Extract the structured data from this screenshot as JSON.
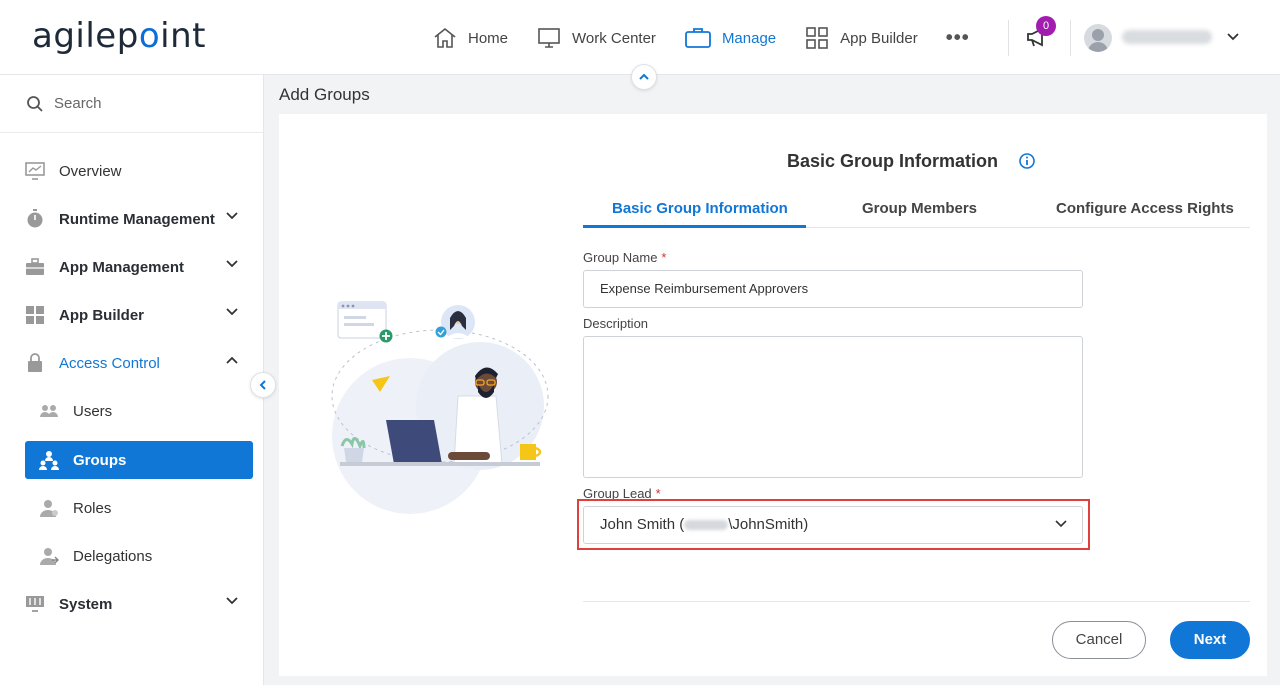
{
  "app": {
    "logo_text": "agilepoint"
  },
  "nav": {
    "items": [
      {
        "label": "Home",
        "icon": "home-icon"
      },
      {
        "label": "Work Center",
        "icon": "monitor-icon"
      },
      {
        "label": "Manage",
        "icon": "briefcase-icon",
        "active": true
      },
      {
        "label": "App Builder",
        "icon": "grid-icon"
      }
    ],
    "more": "•••",
    "notifications_count": "0"
  },
  "sidebar": {
    "search_placeholder": "Search",
    "items": [
      {
        "label": "Overview",
        "icon": "chart-icon"
      },
      {
        "label": "Runtime Management",
        "icon": "timer-icon",
        "expandable": true
      },
      {
        "label": "App Management",
        "icon": "toolbox-icon",
        "expandable": true
      },
      {
        "label": "App Builder",
        "icon": "grid-icon",
        "expandable": true
      },
      {
        "label": "Access Control",
        "icon": "lock-icon",
        "expanded": true
      },
      {
        "label": "Users",
        "icon": "users-icon"
      },
      {
        "label": "Groups",
        "icon": "groups-icon",
        "selected": true
      },
      {
        "label": "Roles",
        "icon": "roles-icon"
      },
      {
        "label": "Delegations",
        "icon": "delegation-icon"
      },
      {
        "label": "System",
        "icon": "sliders-icon",
        "expandable": true
      }
    ]
  },
  "main": {
    "page_title": "Add Groups",
    "section_title": "Basic Group Information",
    "tabs": [
      {
        "label": "Basic Group Information",
        "active": true
      },
      {
        "label": "Group Members"
      },
      {
        "label": "Configure Access Rights"
      }
    ],
    "form": {
      "group_name_label": "Group Name",
      "group_name_value": "Expense Reimbursement Approvers",
      "description_label": "Description",
      "description_value": "",
      "group_lead_label": "Group Lead",
      "group_lead_prefix": "John Smith (",
      "group_lead_suffix": "\\JohnSmith)",
      "required_marker": "*"
    },
    "buttons": {
      "cancel": "Cancel",
      "next": "Next"
    }
  },
  "colors": {
    "accent": "#1177d6",
    "highlight": "#e0403b",
    "badge": "#a21caf"
  }
}
